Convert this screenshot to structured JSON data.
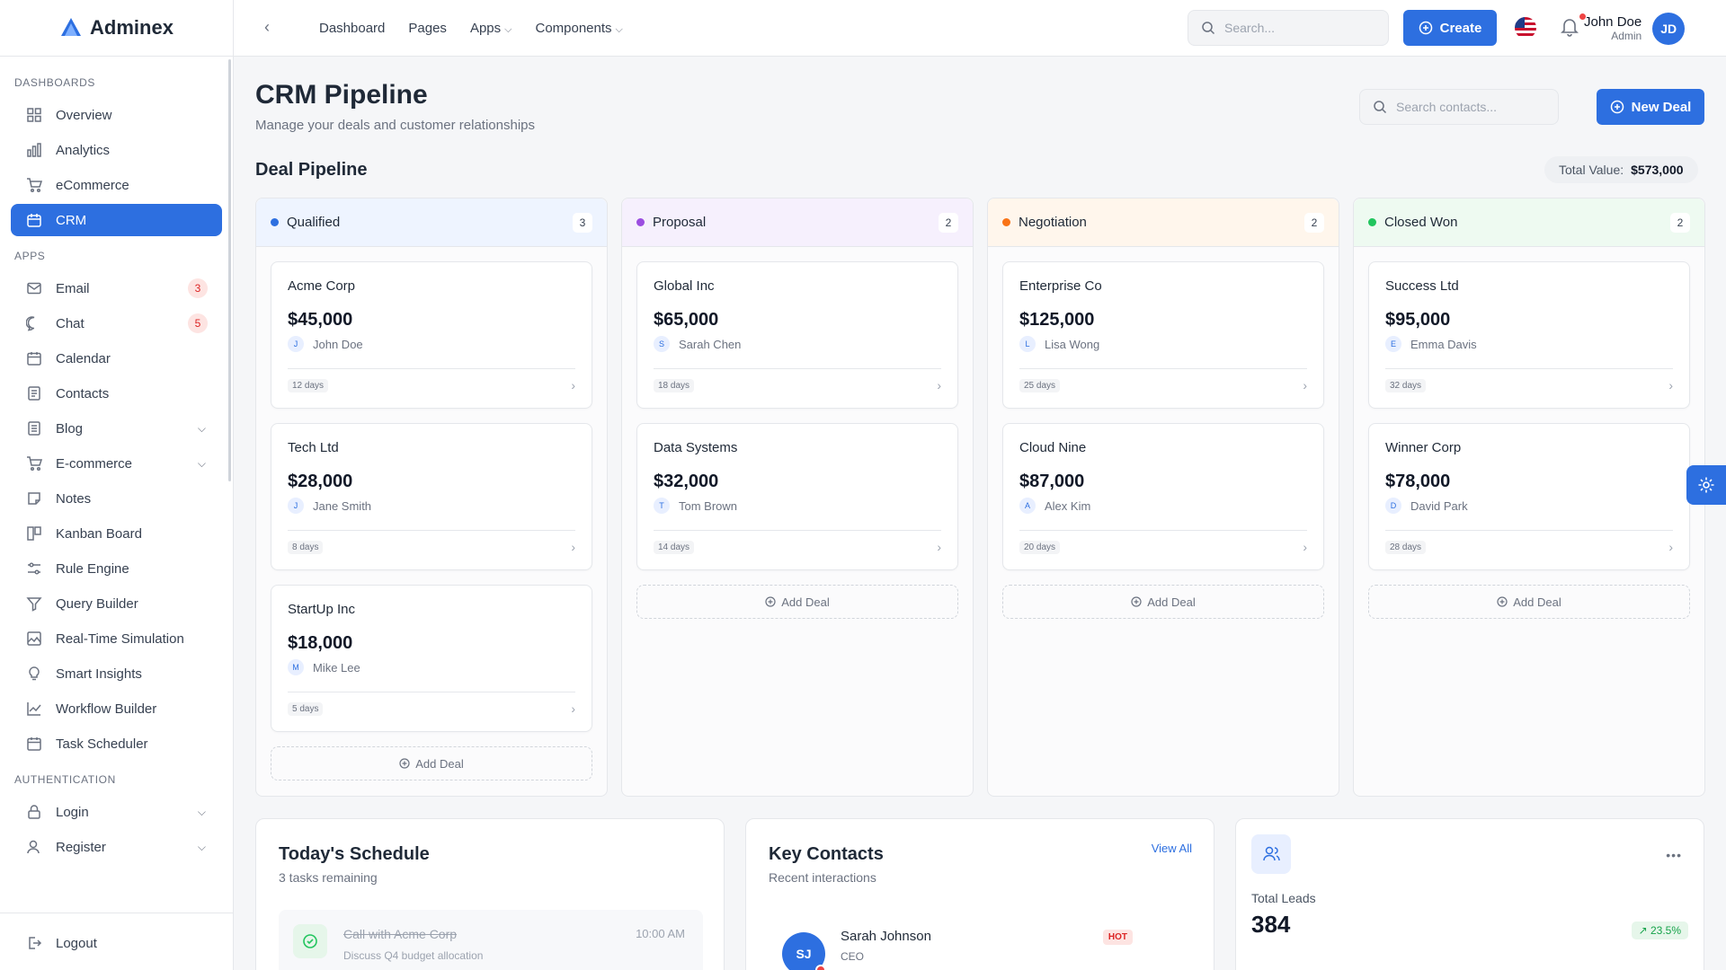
{
  "app": {
    "name": "Adminex"
  },
  "sidebar": {
    "sections": [
      {
        "label": "DASHBOARDS"
      },
      {
        "label": "APPS"
      },
      {
        "label": "AUTHENTICATION"
      }
    ],
    "dashboards": [
      {
        "label": "Overview"
      },
      {
        "label": "Analytics"
      },
      {
        "label": "eCommerce"
      },
      {
        "label": "CRM"
      }
    ],
    "apps": [
      {
        "label": "Email",
        "badge": "3"
      },
      {
        "label": "Chat",
        "badge": "5"
      },
      {
        "label": "Calendar"
      },
      {
        "label": "Contacts"
      },
      {
        "label": "Blog"
      },
      {
        "label": "E-commerce"
      },
      {
        "label": "Notes"
      },
      {
        "label": "Kanban Board"
      },
      {
        "label": "Rule Engine"
      },
      {
        "label": "Query Builder"
      },
      {
        "label": "Real-Time Simulation"
      },
      {
        "label": "Smart Insights"
      },
      {
        "label": "Workflow Builder"
      },
      {
        "label": "Task Scheduler"
      }
    ],
    "auth": [
      {
        "label": "Login"
      },
      {
        "label": "Register"
      }
    ],
    "logout": "Logout"
  },
  "topbar": {
    "nav": [
      {
        "label": "Dashboard"
      },
      {
        "label": "Pages"
      },
      {
        "label": "Apps"
      },
      {
        "label": "Components"
      }
    ],
    "search_placeholder": "Search...",
    "create_label": "Create",
    "user": {
      "name": "John Doe",
      "role": "Admin",
      "initials": "JD"
    }
  },
  "page": {
    "title": "CRM Pipeline",
    "subtitle": "Manage your deals and customer relationships",
    "contact_search_placeholder": "Search contacts...",
    "new_deal_label": "New Deal",
    "pipeline_title": "Deal Pipeline",
    "total_label": "Total Value:",
    "total_value": "$573,000"
  },
  "pipeline": [
    {
      "stage": "Qualified",
      "count": "3",
      "color": "#2d6fe0",
      "bg": "#eef4ff",
      "deals": [
        {
          "company": "Acme Corp",
          "value": "$45,000",
          "initial": "J",
          "owner": "John Doe",
          "days": "12 days"
        },
        {
          "company": "Tech Ltd",
          "value": "$28,000",
          "initial": "J",
          "owner": "Jane Smith",
          "days": "8 days"
        },
        {
          "company": "StartUp Inc",
          "value": "$18,000",
          "initial": "M",
          "owner": "Mike Lee",
          "days": "5 days"
        }
      ]
    },
    {
      "stage": "Proposal",
      "count": "2",
      "color": "#9b4de0",
      "bg": "#f6f0fd",
      "deals": [
        {
          "company": "Global Inc",
          "value": "$65,000",
          "initial": "S",
          "owner": "Sarah Chen",
          "days": "18 days"
        },
        {
          "company": "Data Systems",
          "value": "$32,000",
          "initial": "T",
          "owner": "Tom Brown",
          "days": "14 days"
        }
      ]
    },
    {
      "stage": "Negotiation",
      "count": "2",
      "color": "#f97316",
      "bg": "#fff6ec",
      "deals": [
        {
          "company": "Enterprise Co",
          "value": "$125,000",
          "initial": "L",
          "owner": "Lisa Wong",
          "days": "25 days"
        },
        {
          "company": "Cloud Nine",
          "value": "$87,000",
          "initial": "A",
          "owner": "Alex Kim",
          "days": "20 days"
        }
      ]
    },
    {
      "stage": "Closed Won",
      "count": "2",
      "color": "#22c55e",
      "bg": "#eefaf1",
      "deals": [
        {
          "company": "Success Ltd",
          "value": "$95,000",
          "initial": "E",
          "owner": "Emma Davis",
          "days": "32 days"
        },
        {
          "company": "Winner Corp",
          "value": "$78,000",
          "initial": "D",
          "owner": "David Park",
          "days": "28 days"
        }
      ]
    }
  ],
  "add_deal_label": "Add Deal",
  "schedule": {
    "title": "Today's Schedule",
    "subtitle": "3 tasks remaining",
    "task": {
      "title": "Call with Acme Corp",
      "desc": "Discuss Q4 budget allocation",
      "time": "10:00 AM"
    }
  },
  "contacts": {
    "title": "Key Contacts",
    "subtitle": "Recent interactions",
    "view_all": "View All",
    "first": {
      "initials": "SJ",
      "name": "Sarah Johnson",
      "role": "CEO",
      "tag": "HOT"
    }
  },
  "leads": {
    "label": "Total Leads",
    "value": "384",
    "trend": "↗ 23.5%"
  }
}
